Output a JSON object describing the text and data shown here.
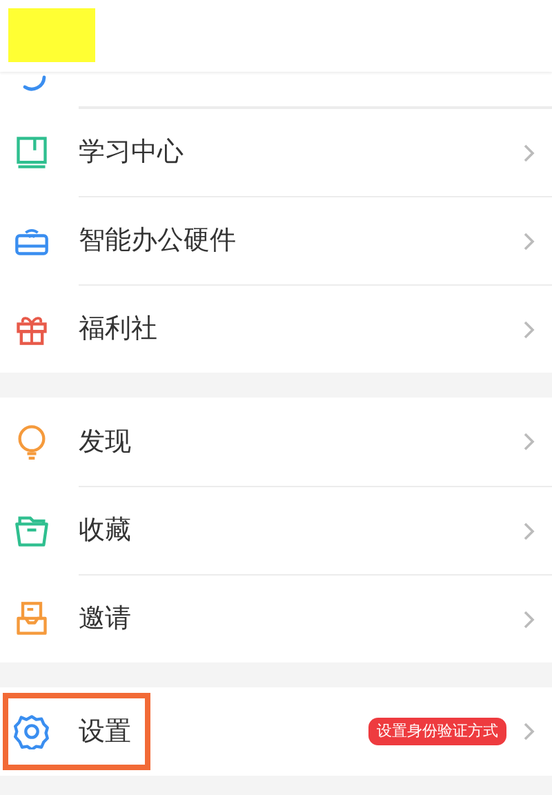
{
  "groups": [
    {
      "items": [
        {
          "label": "学习中心"
        },
        {
          "label": "智能办公硬件"
        },
        {
          "label": "福利社"
        }
      ]
    },
    {
      "items": [
        {
          "label": "发现"
        },
        {
          "label": "收藏"
        },
        {
          "label": "邀请"
        }
      ]
    },
    {
      "items": [
        {
          "label": "设置",
          "badge": "设置身份验证方式",
          "highlighted": true
        }
      ]
    }
  ]
}
